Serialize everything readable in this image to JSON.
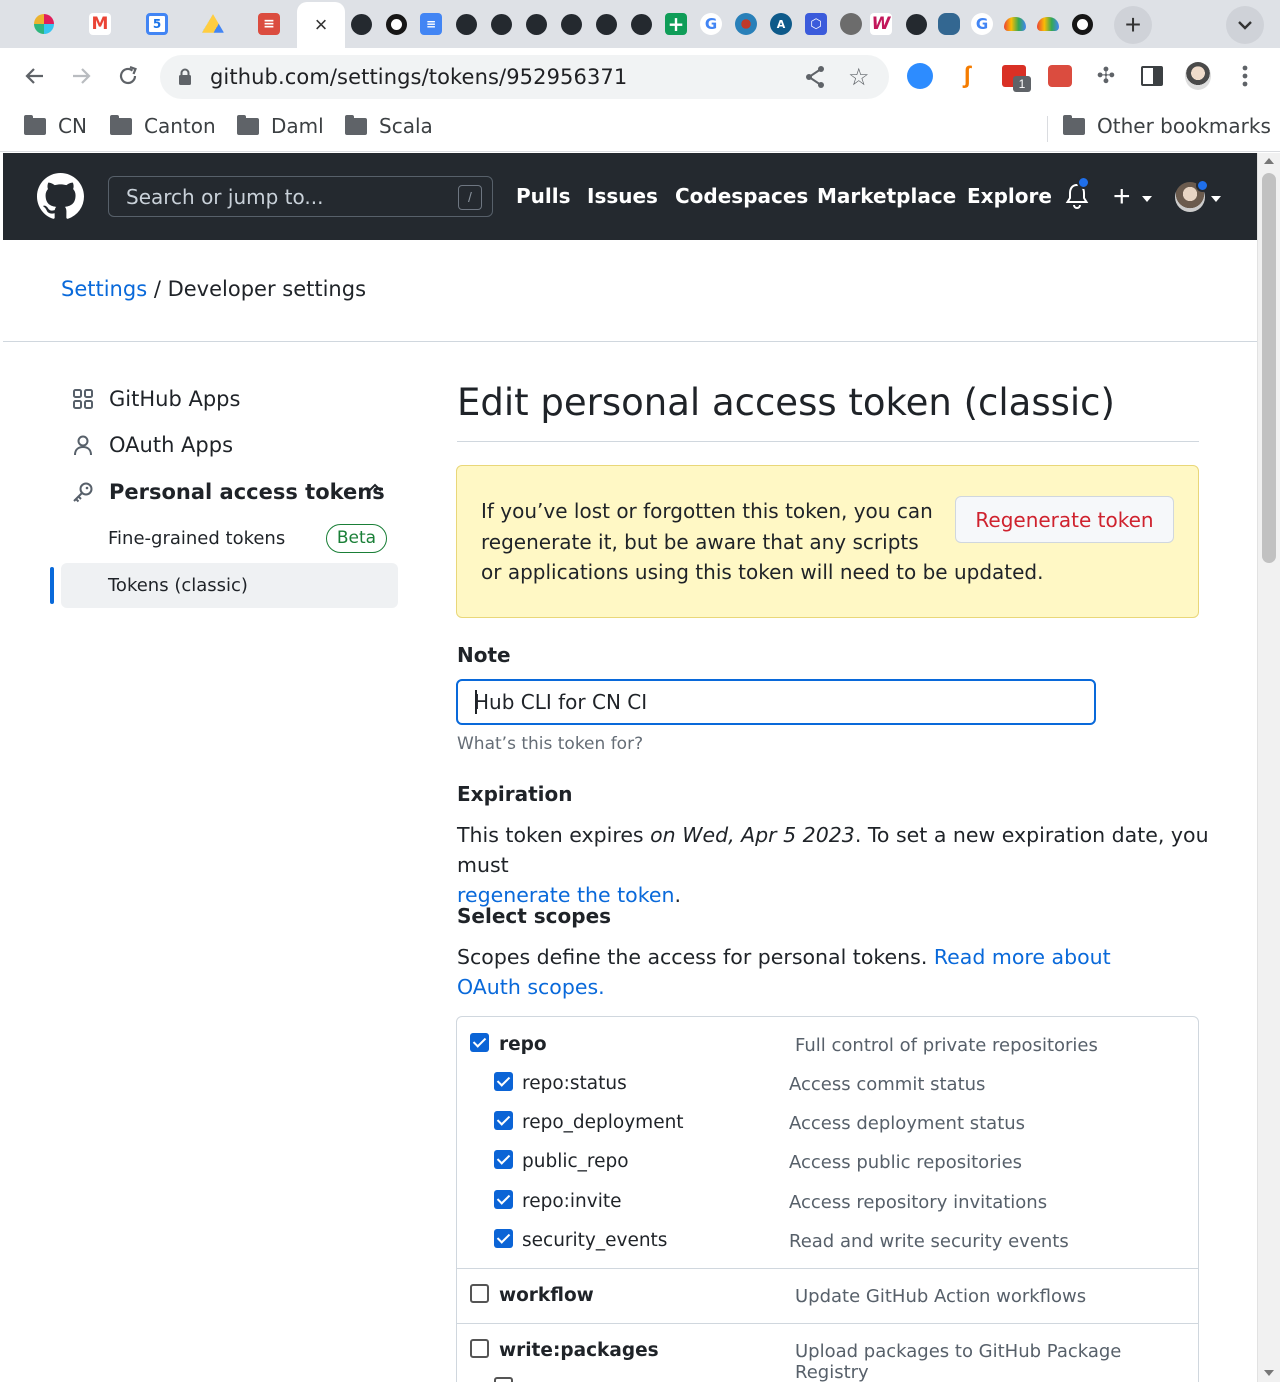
{
  "browser": {
    "tabs": [
      {
        "icon": "slack-icon"
      },
      {
        "icon": "gmail-icon"
      },
      {
        "icon": "calendar-icon",
        "text": "5"
      },
      {
        "icon": "drive-icon"
      },
      {
        "icon": "todoist-icon"
      },
      {
        "icon": "github-icon"
      },
      {
        "icon": "circleci-icon"
      },
      {
        "icon": "docs-icon"
      },
      {
        "icon": "github-icon"
      },
      {
        "icon": "github-icon"
      },
      {
        "icon": "github-icon"
      },
      {
        "icon": "github-icon"
      },
      {
        "icon": "github-icon"
      },
      {
        "icon": "github-icon"
      },
      {
        "icon": "sheets-plus-icon"
      },
      {
        "icon": "google-icon"
      },
      {
        "icon": "globe-icon"
      },
      {
        "icon": "a-icon"
      },
      {
        "icon": "hexagon-icon"
      },
      {
        "icon": "gray-globe-icon"
      },
      {
        "icon": "w-icon"
      },
      {
        "icon": "github-icon"
      },
      {
        "icon": "postgres-icon"
      },
      {
        "icon": "google-icon"
      },
      {
        "icon": "gcloud-icon"
      },
      {
        "icon": "gcloud-icon"
      },
      {
        "icon": "circleci-icon"
      }
    ],
    "active_tab_close": "×",
    "url": "github.com/settings/tokens/952956371",
    "extension_badge": "1",
    "bookmarks": [
      "CN",
      "Canton",
      "Daml",
      "Scala"
    ],
    "other_bookmarks": "Other bookmarks"
  },
  "header": {
    "search_placeholder": "Search or jump to...",
    "search_shortcut": "/",
    "nav": [
      "Pulls",
      "Issues",
      "Codespaces",
      "Marketplace",
      "Explore"
    ]
  },
  "breadcrumb": {
    "settings": "Settings",
    "separator": "/",
    "current": "Developer settings"
  },
  "sidebar": {
    "github_apps": "GitHub Apps",
    "oauth_apps": "OAuth Apps",
    "personal_access_tokens": "Personal access tokens",
    "fine_grained": "Fine-grained tokens",
    "beta": "Beta",
    "tokens_classic": "Tokens (classic)"
  },
  "main": {
    "title": "Edit personal access token (classic)",
    "flash": {
      "line1": "If you’ve lost or forgotten this token, you can",
      "line2": "regenerate it, but be aware that any scripts",
      "line3": "or applications using this token will need to be updated.",
      "button": "Regenerate token"
    },
    "note_label": "Note",
    "note_value": "Hub CLI for CN CI",
    "note_hint": "What’s this token for?",
    "expiration_label": "Expiration",
    "expiration_prefix": "This token expires ",
    "expiration_date": "on Wed, Apr 5 2023",
    "expiration_suffix": ". To set a new expiration date, you must",
    "expiration_link": "regenerate the token",
    "expiration_end": ".",
    "scopes_label": "Select scopes",
    "scopes_desc": "Scopes define the access for personal tokens. ",
    "scopes_link": "Read more about OAuth scopes."
  },
  "scopes": [
    {
      "name": "repo",
      "desc": "Full control of private repositories",
      "checked": true,
      "parent": true
    },
    {
      "name": "repo:status",
      "desc": "Access commit status",
      "checked": true,
      "parent": false
    },
    {
      "name": "repo_deployment",
      "desc": "Access deployment status",
      "checked": true,
      "parent": false
    },
    {
      "name": "public_repo",
      "desc": "Access public repositories",
      "checked": true,
      "parent": false
    },
    {
      "name": "repo:invite",
      "desc": "Access repository invitations",
      "checked": true,
      "parent": false
    },
    {
      "name": "security_events",
      "desc": "Read and write security events",
      "checked": true,
      "parent": false
    },
    {
      "name": "workflow",
      "desc": "Update GitHub Action workflows",
      "checked": false,
      "parent": true
    },
    {
      "name": "write:packages",
      "desc": "Upload packages to GitHub Package Registry",
      "checked": false,
      "parent": true
    }
  ],
  "colors": {
    "link": "#0969da",
    "header_bg": "#24292f",
    "flash_bg": "#fff8c5",
    "danger": "#cf222e",
    "beta_green": "#1a7f37",
    "checkbox": "#0b64d6"
  }
}
